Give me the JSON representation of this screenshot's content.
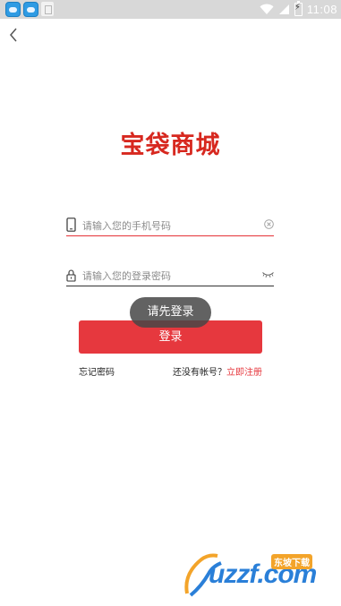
{
  "status_bar": {
    "time": "11:08",
    "icons": [
      "qq-icon",
      "qq-icon",
      "notification-icon",
      "wifi-icon",
      "signal-icon",
      "battery-charging-icon"
    ]
  },
  "header": {
    "back_icon": "chevron-left-icon"
  },
  "logo": {
    "text": "宝袋商城",
    "color": "#d7281f"
  },
  "phone_field": {
    "placeholder": "请输入您的手机号码",
    "value": "",
    "icon": "phone-icon",
    "clear_icon": "clear-icon"
  },
  "password_field": {
    "placeholder": "请输入您的登录密码",
    "value": "",
    "icon": "lock-icon",
    "toggle_icon": "eye-closed-icon"
  },
  "toast": {
    "text": "请先登录"
  },
  "login_button": {
    "label": "登录",
    "color": "#e6383e"
  },
  "links": {
    "forgot_password": "忘记密码",
    "no_account": "还没有帐号？",
    "register": "立即注册"
  },
  "watermark": {
    "text": "uzzf.com",
    "badge": "东坡下载"
  }
}
